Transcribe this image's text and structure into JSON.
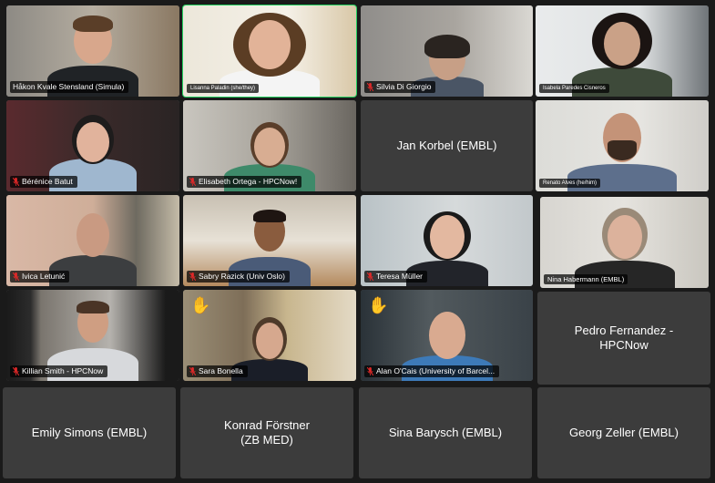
{
  "participants": [
    {
      "name": "Håkon Kvale Stensland (Simula)",
      "muted": false,
      "video": true
    },
    {
      "name": "Lisanna Paladin (she/they)",
      "muted": false,
      "video": true,
      "speaking": true
    },
    {
      "name": "Silvia Di Giorgio",
      "muted": true,
      "video": true
    },
    {
      "name": "Isabela Paredes Cisneros",
      "muted": false,
      "video": true
    },
    {
      "name": "Bérénice Batut",
      "muted": true,
      "video": true
    },
    {
      "name": "Elisabeth Ortega - HPCNow!",
      "muted": true,
      "video": true
    },
    {
      "name": "Jan Korbel (EMBL)",
      "muted": false,
      "video": false
    },
    {
      "name": "Renato Alves (he/him)",
      "muted": false,
      "video": true
    },
    {
      "name": "Ivica Letunić",
      "muted": true,
      "video": true
    },
    {
      "name": "Sabry Razick (Univ Oslo)",
      "muted": true,
      "video": true
    },
    {
      "name": "Teresa Müller",
      "muted": true,
      "video": true
    },
    {
      "name": "Nina Habermann (EMBL)",
      "muted": false,
      "video": true
    },
    {
      "name": "Killian Smith - HPCNow",
      "muted": true,
      "video": true
    },
    {
      "name": "Sara Bonella",
      "muted": true,
      "video": true,
      "hand_raised": true
    },
    {
      "name": "Alan O'Cais (University of Barcel...",
      "muted": true,
      "video": true,
      "hand_raised": true
    },
    {
      "name": "Pedro Fernandez - HPCNow",
      "muted": false,
      "video": false
    },
    {
      "name": "Emily Simons (EMBL)",
      "muted": false,
      "video": false
    },
    {
      "name": "Konrad Förstner (ZB MED)",
      "muted": false,
      "video": false
    },
    {
      "name": "Sina Barysch (EMBL)",
      "muted": false,
      "video": false
    },
    {
      "name": "Georg Zeller (EMBL)",
      "muted": false,
      "video": false
    }
  ],
  "colors": {
    "background": "#1a1a1a",
    "tile_no_video": "#3c3c3c",
    "muted_icon": "#e02828",
    "active_speaker": "#23d160"
  },
  "icons": {
    "muted": "mic-off-icon",
    "hand": "raised-hand-icon"
  }
}
